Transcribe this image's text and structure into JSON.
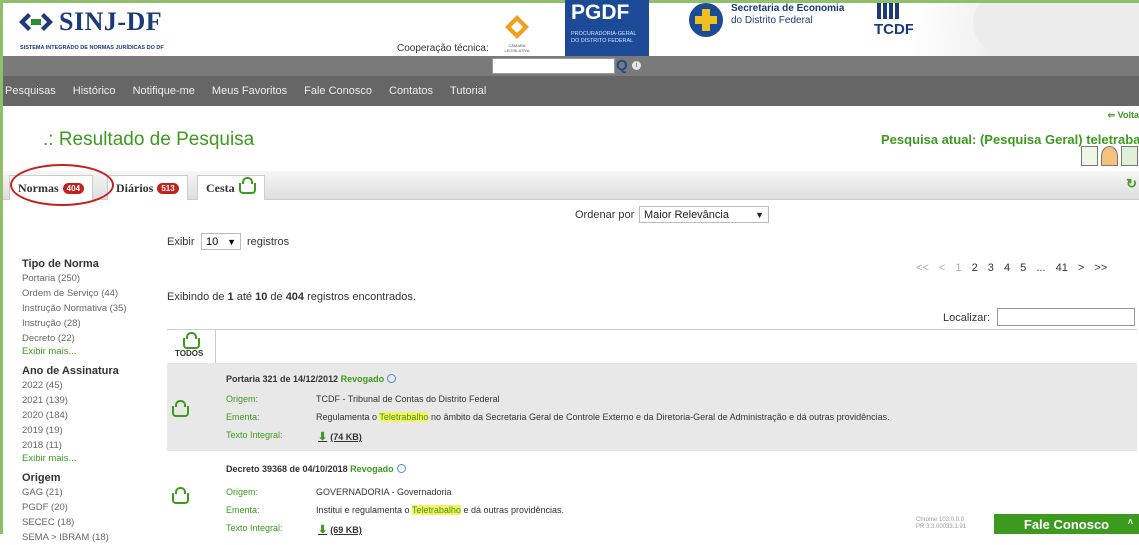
{
  "header": {
    "logo_title": "SINJ-DF",
    "logo_subtitle": "SISTEMA INTEGRADO DE NORMAS JURÍDICAS DO DF",
    "cooperacao": "Cooperação técnica:",
    "camara_text": "CÂMARA LEGISLATIVA",
    "pgdf_title": "PGDF",
    "pgdf_sub1": "PROCURADORIA-GERAL",
    "pgdf_sub2": "DO DISTRITO FEDERAL",
    "seca_line1": "Secretaria de Economia",
    "seca_line2": "do Distrito Federal",
    "tcdf": "TCDF"
  },
  "search": {
    "button_icon": "search-icon",
    "advanced_icon": "info-icon"
  },
  "nav": [
    "Pesquisas",
    "Histórico",
    "Notifique-me",
    "Meus Favoritos",
    "Fale Conosco",
    "Contatos",
    "Tutorial"
  ],
  "titlebar": {
    "voltar": "Volta",
    "page_title": ".: Resultado de Pesquisa",
    "atual": "Pesquisa atual: (Pesquisa Geral) teletrabalho"
  },
  "tabs": {
    "normas": "Normas",
    "normas_count": "404",
    "diarios": "Diários",
    "diarios_count": "513",
    "cesta": "Cesta"
  },
  "sidebar": {
    "tipo_heading": "Tipo de Norma",
    "tipo": [
      "Portaria (250)",
      "Ordem de Serviço (44)",
      "Instrução Normativa (35)",
      "Instrução (28)",
      "Decreto (22)"
    ],
    "ano_heading": "Ano de Assinatura",
    "ano": [
      "2022 (45)",
      "2021 (139)",
      "2020 (184)",
      "2019 (19)",
      "2018 (11)"
    ],
    "origem_heading": "Origem",
    "origem": [
      "GAG (21)",
      "PGDF (20)",
      "SECEC (18)",
      "SEMA > IBRAM (18)"
    ],
    "exibir_mais": "Exibir mais..."
  },
  "controls": {
    "ordenar_label": "Ordenar por",
    "ordenar_value": "Maior Relevância",
    "exibir_label": "Exibir",
    "exibir_value": "10",
    "registros": "registros",
    "pager": [
      "<<",
      "<",
      "1",
      "2",
      "3",
      "4",
      "5",
      "...",
      "41",
      ">",
      ">>"
    ],
    "summary_pre": "Exibindo de ",
    "summary_from": "1",
    "summary_mid1": " até ",
    "summary_to": "10",
    "summary_mid2": " de ",
    "summary_total": "404",
    "summary_post": " registros encontrados.",
    "localizar": "Localizar:",
    "todos": "TODOS"
  },
  "results": [
    {
      "title": "Portaria 321 de 14/12/2012",
      "status": "Revogado",
      "origem_label": "Origem:",
      "origem": "TCDF - Tribunal de Contas do Distrito Federal",
      "ementa_label": "Ementa:",
      "ementa_pre": "Regulamenta o ",
      "ementa_hl": "Teletrabalho",
      "ementa_post": " no âmbito da Secretaria Geral de Controle Externo e da Diretoria-Geral de Administração e dá outras providências.",
      "texto_label": "Texto Integral:",
      "size": "(74 KB)"
    },
    {
      "title": "Decreto 39368 de 04/10/2018",
      "status": "Revogado",
      "origem_label": "Origem:",
      "origem": "GOVERNADORIA - Governadoria",
      "ementa_label": "Ementa:",
      "ementa_pre": "Institui e regulamenta o ",
      "ementa_hl": "Teletrabalho",
      "ementa_post": " e dá outras providências.",
      "texto_label": "Texto Integral:",
      "size": "(69 KB)"
    }
  ],
  "footer": {
    "browser_line1": "Chrome 103.0.0.0",
    "browser_line2": "PR 3.3.00033.1.91",
    "fale": "Fale Conosco"
  }
}
